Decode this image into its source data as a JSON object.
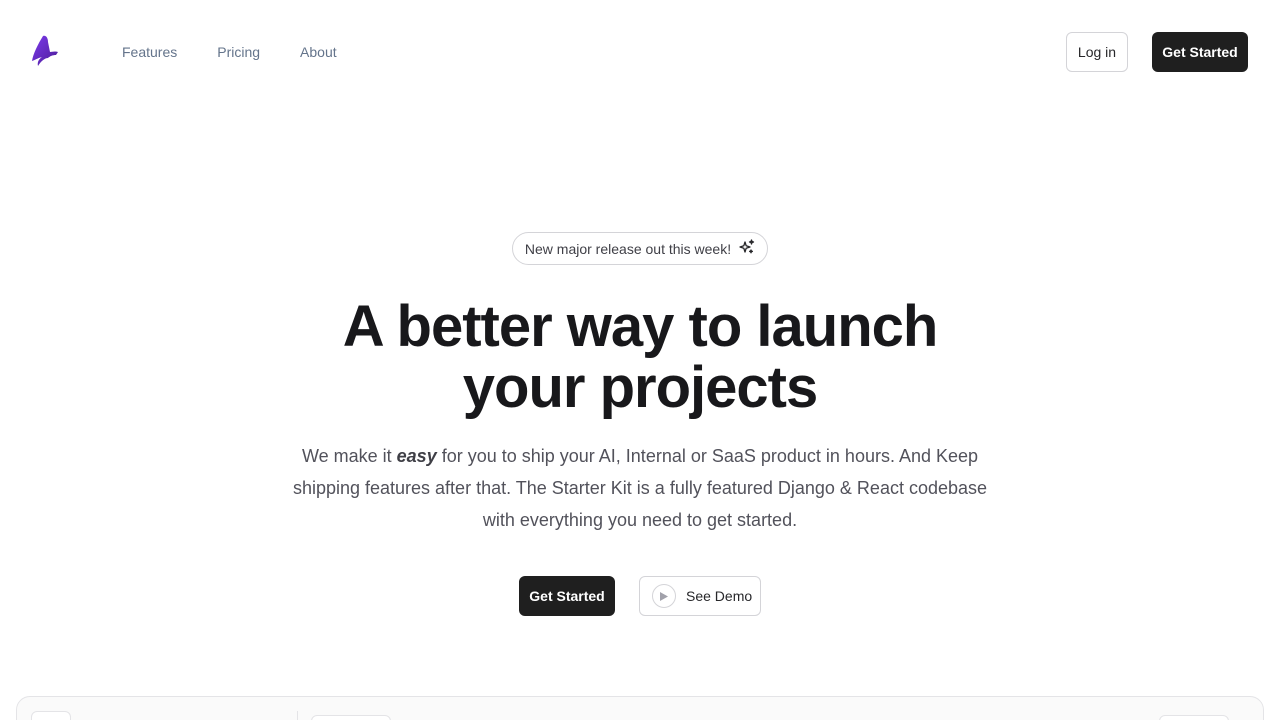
{
  "brand": {
    "logo_icon": "brand-logo-icon",
    "logo_color": "#6d28d9"
  },
  "nav": {
    "links": [
      "Features",
      "Pricing",
      "About"
    ],
    "login_label": "Log in",
    "get_started_label": "Get Started"
  },
  "hero": {
    "badge_text": "New major release out this week!",
    "badge_icon": "sparkles-icon",
    "headline_line1": "A better way to launch",
    "headline_line2": "your projects",
    "subtitle_pre": "We make it ",
    "subtitle_emphasis": "easy",
    "subtitle_post": " for you to ship your AI, Internal or SaaS product in hours. And Keep shipping features after that. The Starter Kit is a fully featured Django & React codebase with everything you need to get started.",
    "primary_cta_label": "Get Started",
    "demo_cta_label": "See Demo",
    "demo_icon": "play-icon"
  },
  "colors": {
    "primary_button": "#1f1f1f",
    "text_muted": "#52525b",
    "border": "#d4d4d8"
  }
}
